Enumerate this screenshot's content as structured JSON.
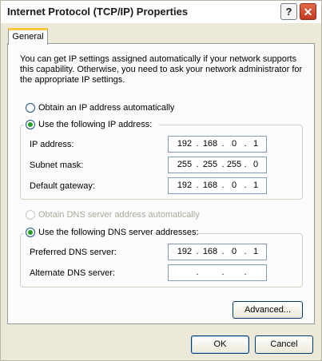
{
  "window": {
    "title": "Internet Protocol (TCP/IP) Properties",
    "help_label": "?",
    "close_label": "✕"
  },
  "tabs": [
    {
      "label": "General",
      "selected": true
    }
  ],
  "description": "You can get IP settings assigned automatically if your network supports this capability. Otherwise, you need to ask your network administrator for the appropriate IP settings.",
  "ip_settings": {
    "auto_option": {
      "label": "Obtain an IP address automatically",
      "checked": false
    },
    "manual_option": {
      "label": "Use the following IP address:",
      "checked": true
    },
    "fields": [
      {
        "label": "IP address:",
        "octets": [
          "192",
          "168",
          "0",
          "1"
        ]
      },
      {
        "label": "Subnet mask:",
        "octets": [
          "255",
          "255",
          "255",
          "0"
        ]
      },
      {
        "label": "Default gateway:",
        "octets": [
          "192",
          "168",
          "0",
          "1"
        ]
      }
    ]
  },
  "dns_settings": {
    "auto_option": {
      "label": "Obtain DNS server address automatically",
      "checked": false,
      "enabled": false
    },
    "manual_option": {
      "label": "Use the following DNS server addresses:",
      "checked": true
    },
    "fields": [
      {
        "label": "Preferred DNS server:",
        "octets": [
          "192",
          "168",
          "0",
          "1"
        ]
      },
      {
        "label": "Alternate DNS server:",
        "octets": [
          "",
          "",
          "",
          ""
        ]
      }
    ]
  },
  "buttons": {
    "advanced": "Advanced...",
    "ok": "OK",
    "cancel": "Cancel"
  },
  "colors": {
    "dialog_bg": "#ece9d8",
    "panel_bg": "#fcfcfe",
    "tab_highlight": "#ffc83c",
    "radio_dot": "#21a121",
    "close_button": "#c0391f"
  }
}
